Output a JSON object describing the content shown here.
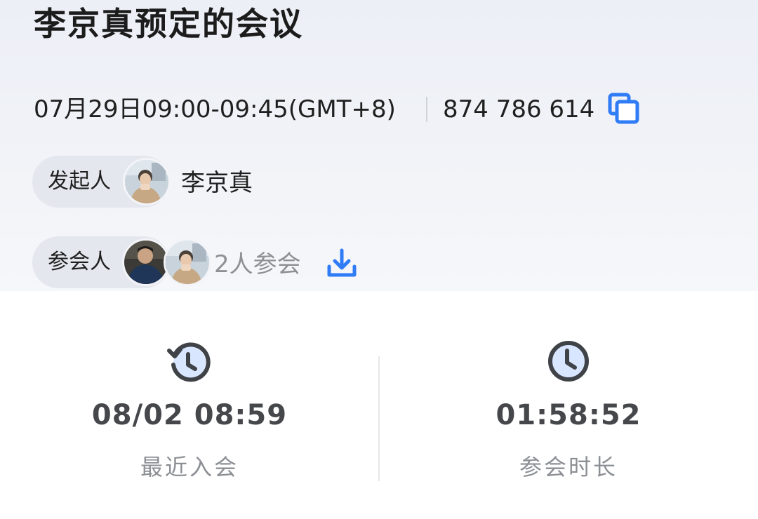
{
  "meeting": {
    "title": "李京真预定的会议",
    "time": "07月29日09:00-09:45(GMT+8)",
    "id": "874 786 614"
  },
  "organizer": {
    "label": "发起人",
    "name": "李京真"
  },
  "participants": {
    "label": "参会人",
    "count_text": "2人参会"
  },
  "stats": [
    {
      "value": "08/02 08:59",
      "label": "最近入会",
      "icon": "history-clock-icon"
    },
    {
      "value": "01:58:52",
      "label": "参会时长",
      "icon": "clock-icon"
    }
  ],
  "colors": {
    "accent": "#2f7cf6",
    "icon_dark": "#3f4247",
    "icon_fill": "#d8e6ff",
    "muted_text": "#8e9094",
    "header_bg": "#eef0f6",
    "pill_bg": "#e4e7ee"
  }
}
